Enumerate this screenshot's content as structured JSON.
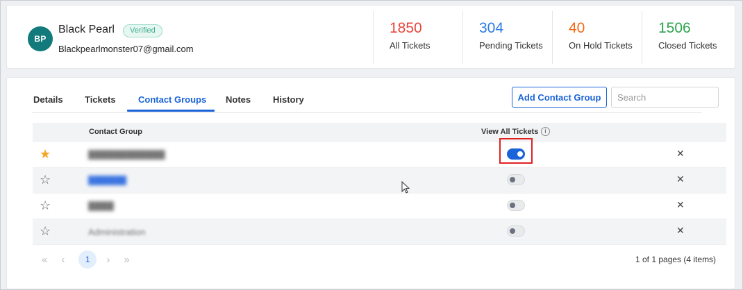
{
  "contact": {
    "initials": "BP",
    "name": "Black Pearl",
    "verified_label": "Verified",
    "email": "Blackpearlmonster07@gmail.com"
  },
  "stats": [
    {
      "value": "1850",
      "label": "All Tickets",
      "color": "#e8453c"
    },
    {
      "value": "304",
      "label": "Pending Tickets",
      "color": "#2f7be5"
    },
    {
      "value": "40",
      "label": "On Hold Tickets",
      "color": "#f26a1b"
    },
    {
      "value": "1506",
      "label": "Closed Tickets",
      "color": "#2ea44f"
    }
  ],
  "tabs": [
    {
      "label": "Details"
    },
    {
      "label": "Tickets"
    },
    {
      "label": "Contact Groups"
    },
    {
      "label": "Notes"
    },
    {
      "label": "History"
    }
  ],
  "active_tab": "Contact Groups",
  "toolbar": {
    "add_label": "Add Contact Group",
    "search_placeholder": "Search"
  },
  "table": {
    "columns": {
      "group": "Contact Group",
      "view_all": "View All Tickets"
    },
    "rows": [
      {
        "starred": true,
        "name": "████████████",
        "view_all": true
      },
      {
        "starred": false,
        "name": "██████",
        "view_all": false
      },
      {
        "starred": false,
        "name": "████",
        "view_all": false
      },
      {
        "starred": false,
        "name": "Administration",
        "view_all": false
      }
    ]
  },
  "pagination": {
    "current_page": "1",
    "info": "1 of 1 pages (4 items)"
  },
  "icons": {
    "info": "info-icon",
    "star_filled": "star-filled-icon",
    "star_empty": "star-outline-icon",
    "remove": "close-icon"
  }
}
